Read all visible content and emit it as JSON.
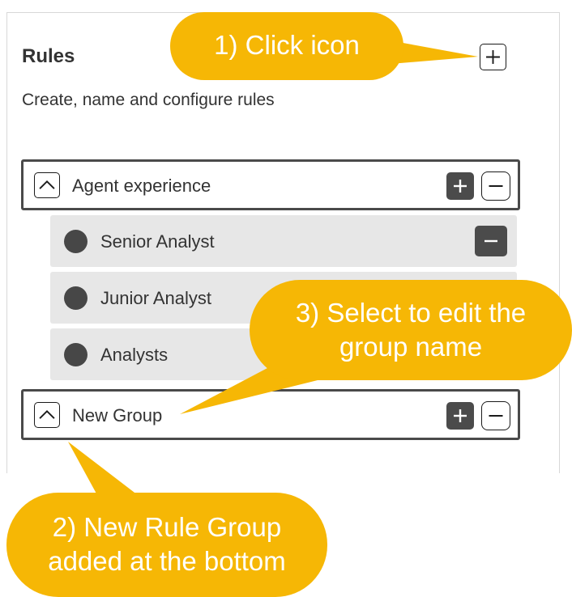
{
  "rules_panel": {
    "title": "Rules",
    "subtitle": "Create, name and configure rules",
    "add_icon": "plus-square-icon"
  },
  "groups": [
    {
      "name": "Agent experience",
      "expanded": true,
      "collapse_icon": "chevron-up-icon",
      "add_icon": "plus-icon",
      "remove_icon": "minus-icon",
      "rules": [
        {
          "name": "Senior Analyst",
          "icon": "circle-icon",
          "remove_icon": "minus-icon"
        },
        {
          "name": "Junior Analyst",
          "icon": "circle-icon"
        },
        {
          "name": "Analysts",
          "icon": "circle-icon"
        }
      ]
    },
    {
      "name": "New Group",
      "expanded": true,
      "collapse_icon": "chevron-up-icon",
      "add_icon": "plus-icon",
      "remove_icon": "minus-icon",
      "rules": []
    }
  ],
  "callouts": {
    "step1": {
      "lines": [
        "1) Click icon"
      ]
    },
    "step2": {
      "lines": [
        "2) New Rule Group",
        "added at the bottom"
      ]
    },
    "step3": {
      "lines": [
        "3) Select to edit the",
        "group name"
      ]
    }
  },
  "colors": {
    "callout": "#f6b705",
    "callout_text": "#ffffff",
    "dark_button": "#4b4b4b",
    "rule_row_bg": "#e7e7e7",
    "text": "#333333"
  }
}
